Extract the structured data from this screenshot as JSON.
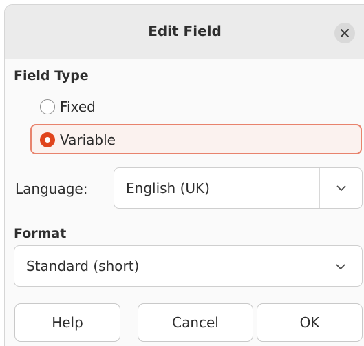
{
  "dialog": {
    "title": "Edit Field",
    "close_icon": "close-icon"
  },
  "field_type": {
    "heading": "Field Type",
    "options": [
      {
        "label": "Fixed",
        "selected": false
      },
      {
        "label": "Variable",
        "selected": true
      }
    ]
  },
  "language": {
    "label": "Language:",
    "value": "English (UK)"
  },
  "format": {
    "heading": "Format",
    "value": "Standard (short)"
  },
  "buttons": {
    "help": "Help",
    "cancel": "Cancel",
    "ok": "OK"
  },
  "colors": {
    "accent": "#e0441c",
    "selection_border": "#e8836d",
    "titlebar": "#ebebeb"
  }
}
